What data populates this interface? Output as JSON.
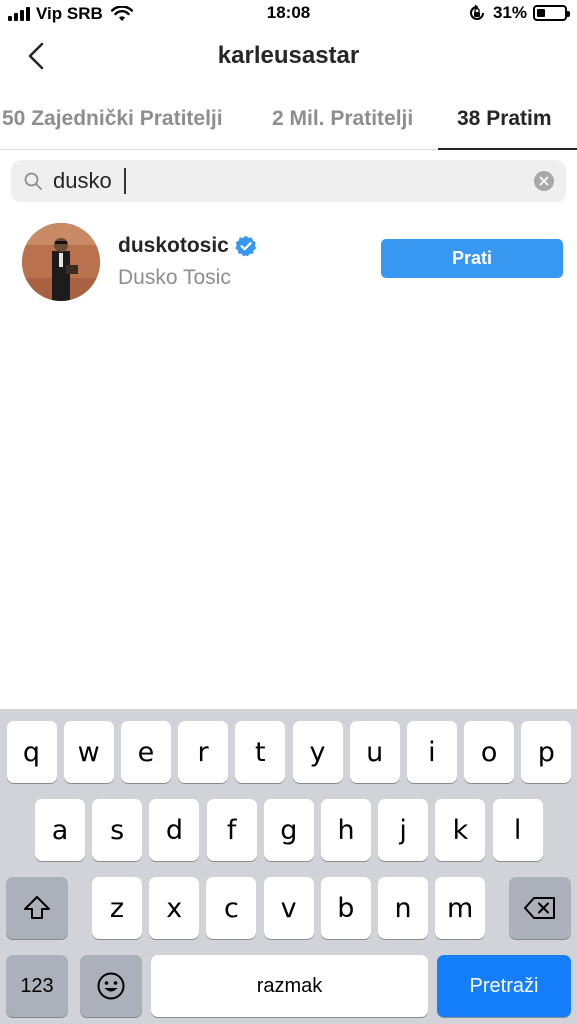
{
  "status_bar": {
    "carrier": "Vip SRB",
    "time": "18:08",
    "battery_pct": "31%",
    "battery_level": 0.31
  },
  "header": {
    "title": "karleusastar"
  },
  "tabs": [
    {
      "label": "50 Zajednički Pratitelji",
      "active": false
    },
    {
      "label": "2 Mil. Pratitelji",
      "active": false
    },
    {
      "label": "38 Pratim",
      "active": true
    }
  ],
  "search": {
    "value": "dusko",
    "icon": "search-icon"
  },
  "results": [
    {
      "username": "duskotosic",
      "full_name": "Dusko Tosic",
      "verified": true,
      "action_label": "Prati"
    }
  ],
  "keyboard": {
    "row1": [
      "q",
      "w",
      "e",
      "r",
      "t",
      "y",
      "u",
      "i",
      "o",
      "p"
    ],
    "row2": [
      "a",
      "s",
      "d",
      "f",
      "g",
      "h",
      "j",
      "k",
      "l"
    ],
    "row3": [
      "z",
      "x",
      "c",
      "v",
      "b",
      "n",
      "m"
    ],
    "numbers_label": "123",
    "space_label": "razmak",
    "return_label": "Pretraži"
  },
  "colors": {
    "accent": "#3897f0",
    "search_key": "#147efb",
    "verified": "#3897f0",
    "keyboard_bg": "#d1d3d9"
  }
}
